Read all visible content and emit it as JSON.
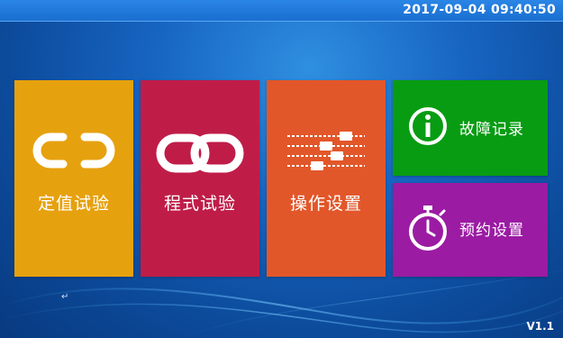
{
  "statusbar": {
    "datetime": "2017-09-04 09:40:50"
  },
  "tiles": [
    {
      "id": "fixed-value-test",
      "label": "定值试验",
      "icon": "link-open-icon",
      "color": "#e6a10e"
    },
    {
      "id": "program-test",
      "label": "程式试验",
      "icon": "chain-link-icon",
      "color": "#bf1d48"
    },
    {
      "id": "operation-settings",
      "label": "操作设置",
      "icon": "sliders-icon",
      "color": "#e2572a"
    },
    {
      "id": "fault-records",
      "label": "故障记录",
      "icon": "info-icon",
      "color": "#089c13"
    },
    {
      "id": "reservation-settings",
      "label": "预约设置",
      "icon": "stopwatch-icon",
      "color": "#9b1ba3"
    }
  ],
  "footer": {
    "version": "V1.1",
    "stray_mark": "↵"
  }
}
